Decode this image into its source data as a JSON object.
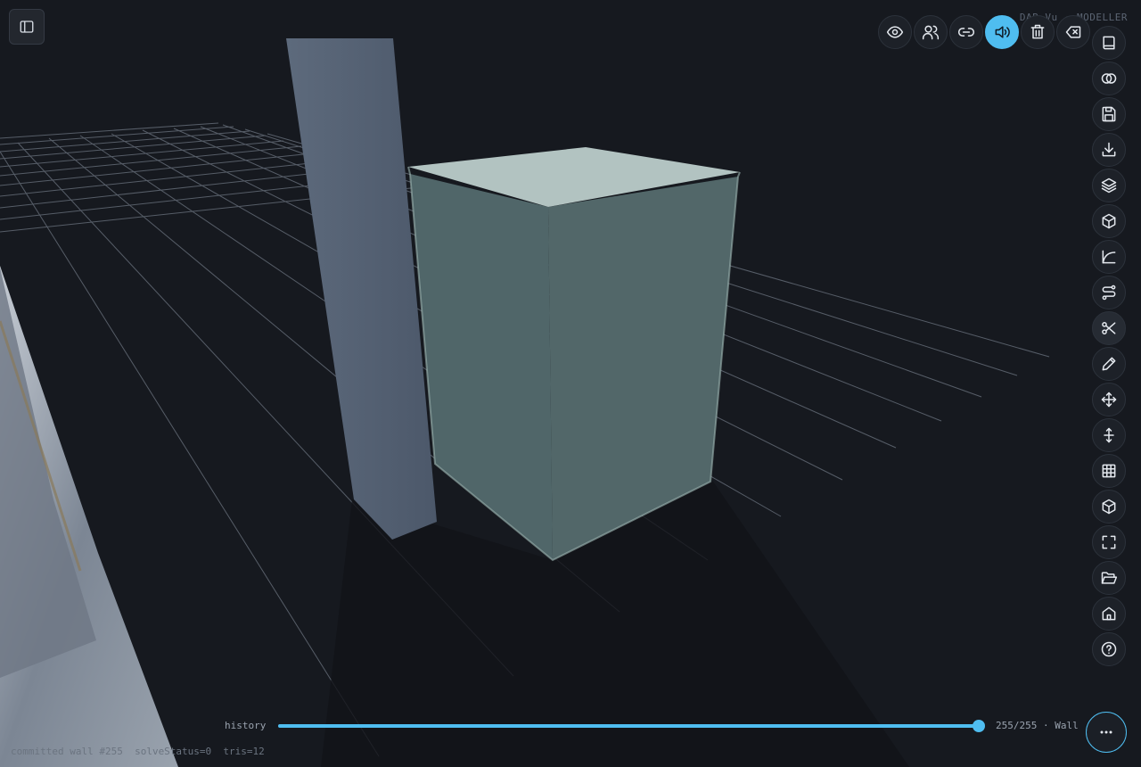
{
  "app": {
    "brand": "DAB Vu · MODELLER"
  },
  "toolbar": {
    "top": [
      {
        "name": "visibility-button",
        "icon": "eye-icon",
        "active": false
      },
      {
        "name": "users-button",
        "icon": "users-icon",
        "active": false
      },
      {
        "name": "link-button",
        "icon": "link-icon",
        "active": false
      },
      {
        "name": "sound-button",
        "icon": "speaker-icon",
        "active": true
      },
      {
        "name": "delete-button",
        "icon": "trash-icon",
        "active": false
      },
      {
        "name": "erase-button",
        "icon": "backspace-icon",
        "active": false
      }
    ],
    "right": [
      {
        "name": "library-button",
        "icon": "book-icon"
      },
      {
        "name": "boolean-button",
        "icon": "intersect-icon"
      },
      {
        "name": "save-button",
        "icon": "floppy-icon"
      },
      {
        "name": "download-button",
        "icon": "download-icon"
      },
      {
        "name": "layers-button",
        "icon": "layers-icon"
      },
      {
        "name": "box-button",
        "icon": "cube-icon"
      },
      {
        "name": "curve-button",
        "icon": "curve-icon"
      },
      {
        "name": "route-button",
        "icon": "route-icon"
      },
      {
        "name": "cut-button",
        "icon": "scissors-icon"
      },
      {
        "name": "edit-button",
        "icon": "pencil-icon"
      },
      {
        "name": "move-button",
        "icon": "move-icon"
      },
      {
        "name": "move-vertical-button",
        "icon": "move-vertical-icon"
      },
      {
        "name": "grid-button",
        "icon": "grid-icon"
      },
      {
        "name": "package-button",
        "icon": "package-icon"
      },
      {
        "name": "fullscreen-button",
        "icon": "fullscreen-icon"
      },
      {
        "name": "open-folder-button",
        "icon": "folder-open-icon"
      },
      {
        "name": "home-button",
        "icon": "home-icon"
      },
      {
        "name": "help-button",
        "icon": "help-icon"
      }
    ]
  },
  "history": {
    "label": "history",
    "progress": 1.0,
    "readout": "255/255 · Wall"
  },
  "status": {
    "text": "committed wall #255  solveStatus=0  tris=12"
  },
  "colors": {
    "accent": "#4fbdf0",
    "background": "#16191f"
  }
}
